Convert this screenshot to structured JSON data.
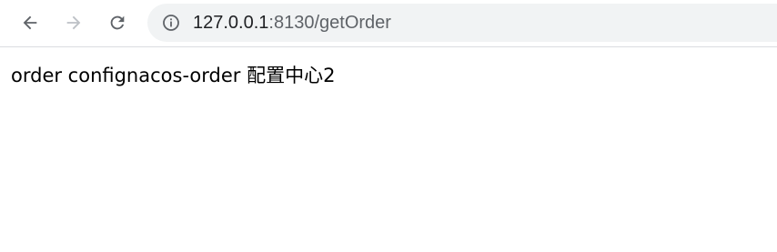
{
  "browser": {
    "url_host": "127.0.0.1",
    "url_rest": ":8130/getOrder",
    "icons": {
      "back": "back-arrow-icon",
      "forward": "forward-arrow-icon",
      "reload": "reload-icon",
      "site_info": "info-icon"
    },
    "colors": {
      "omnibox_bg": "#f1f3f4",
      "icon_active": "#5f6368",
      "icon_disabled": "#bdc1c6"
    }
  },
  "page": {
    "body_text": "order confignacos-order 配置中心2"
  }
}
